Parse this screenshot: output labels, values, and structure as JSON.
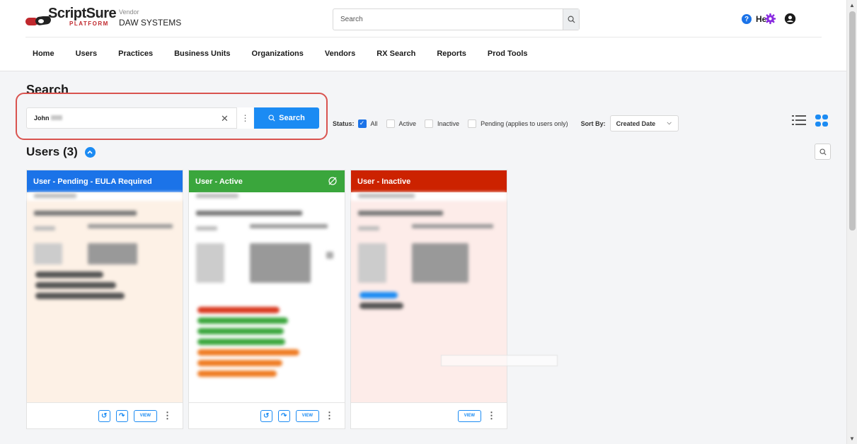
{
  "header": {
    "logo_text": "ScriptSure",
    "logo_sub": "PLATFORM",
    "vendor_label": "Vendor",
    "vendor_name": "DAW SYSTEMS",
    "search_placeholder": "Search",
    "help_label": "Help"
  },
  "nav": [
    "Home",
    "Users",
    "Practices",
    "Business Units",
    "Organizations",
    "Vendors",
    "RX Search",
    "Reports",
    "Prod Tools"
  ],
  "search": {
    "title": "Search",
    "input_value": "John",
    "button_label": "Search",
    "status_label": "Status:",
    "options": [
      {
        "label": "All",
        "checked": true
      },
      {
        "label": "Active",
        "checked": false
      },
      {
        "label": "Inactive",
        "checked": false
      },
      {
        "label": "Pending (applies to users only)",
        "checked": false
      }
    ],
    "sort_label": "Sort By:",
    "sort_value": "Created Date"
  },
  "results": {
    "title": "Users (3)"
  },
  "cards": [
    {
      "header": "User - Pending - EULA Required",
      "color": "#1b73e8",
      "bg": "#fdf1e6"
    },
    {
      "header": "User - Active",
      "color": "#3aa63c",
      "bg": "#ffffff"
    },
    {
      "header": "User - Inactive",
      "color": "#cc2200",
      "bg": "#fdece9"
    }
  ],
  "card_view_label": "VIEW",
  "icons": {
    "search": "search-icon",
    "help": "help-icon",
    "settings": "gear-icon",
    "account": "account-icon"
  }
}
